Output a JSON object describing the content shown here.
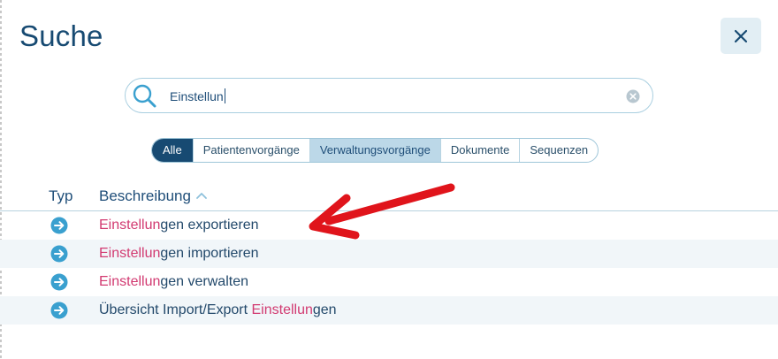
{
  "dialog": {
    "title": "Suche"
  },
  "search": {
    "value": "Einstellun"
  },
  "filters": [
    {
      "label": "Alle",
      "state": "selected"
    },
    {
      "label": "Patientenvorgänge",
      "state": "normal"
    },
    {
      "label": "Verwaltungsvorgänge",
      "state": "active"
    },
    {
      "label": "Dokumente",
      "state": "normal"
    },
    {
      "label": "Sequenzen",
      "state": "normal"
    }
  ],
  "table": {
    "headers": {
      "type": "Typ",
      "description": "Beschreibung"
    },
    "rows": [
      {
        "prefix": "",
        "match": "Einstellun",
        "suffix": "gen exportieren"
      },
      {
        "prefix": "",
        "match": "Einstellun",
        "suffix": "gen importieren"
      },
      {
        "prefix": "",
        "match": "Einstellun",
        "suffix": "gen verwalten"
      },
      {
        "prefix": "Übersicht Import/Export ",
        "match": "Einstellun",
        "suffix": "gen"
      }
    ]
  },
  "colors": {
    "primary": "#174a72",
    "highlight": "#d23a71",
    "icon_accent": "#3aa0cf",
    "annotation": "#e0141b"
  }
}
